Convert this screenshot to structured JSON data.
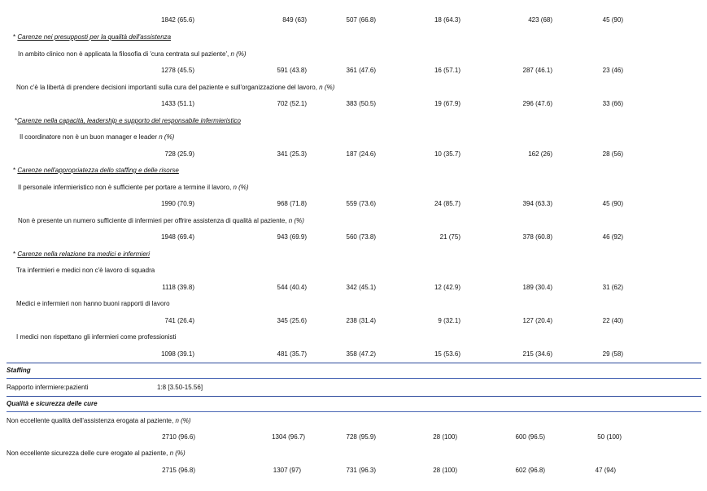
{
  "rows": [
    {
      "type": "values",
      "cells": [
        "1842 (65.6)",
        "849 (63)",
        "507 (66.8)",
        "18 (64.3)",
        "423 (68)",
        "45 (90)"
      ]
    },
    {
      "type": "category",
      "prefix": "* ",
      "label": "Carenze nei presupposti per la qualità dell'assistenza"
    },
    {
      "type": "item",
      "label": "In ambito clinico non è applicata la filosofia di 'cura centrata sul paziente', ",
      "suffix": "n (%)"
    },
    {
      "type": "values",
      "cells": [
        "1278 (45.5)",
        "591 (43.8)",
        "361 (47.6)",
        "16 (57.1)",
        "287 (46.1)",
        "23 (46)"
      ]
    },
    {
      "type": "item",
      "label": "Non c'è la libertà di prendere decisioni importanti sulla cura del paziente e sull'organizzazione del lavoro, ",
      "suffix": "n (%)"
    },
    {
      "type": "values",
      "cells": [
        "1433 (51.1)",
        "702 (52.1)",
        "383 (50.5)",
        "19 (67.9)",
        "296 (47.6)",
        "33 (66)"
      ]
    },
    {
      "type": "category",
      "prefix": "*",
      "label": "Carenze nella capacità, leadership e supporto del responsabile infermieristico"
    },
    {
      "type": "item",
      "label": "Il coordinatore non è un buon manager e leader ",
      "suffix": "n (%)"
    },
    {
      "type": "values",
      "cells": [
        "728 (25.9)",
        "341 (25.3)",
        "187 (24.6)",
        "10 (35.7)",
        "162 (26)",
        "28 (56)"
      ]
    },
    {
      "type": "category",
      "prefix": "* ",
      "label": "Carenze nell'appropriatezza dello staffing e delle risorse"
    },
    {
      "type": "item",
      "label": "Il personale infermieristico non è sufficiente per portare a termine il lavoro, ",
      "suffix": "n (%)"
    },
    {
      "type": "values",
      "cells": [
        "1990 (70.9)",
        "968 (71.8)",
        "559 (73.6)",
        "24 (85.7)",
        "394 (63.3)",
        "45 (90)"
      ]
    },
    {
      "type": "item",
      "label": "Non è presente un numero sufficiente di infermieri per offrire assistenza di qualità al paziente, ",
      "suffix": "n (%)"
    },
    {
      "type": "values",
      "cells": [
        "1948 (69.4)",
        "943 (69.9)",
        "560 (73.8)",
        "21 (75)",
        "378 (60.8)",
        "46 (92)"
      ]
    },
    {
      "type": "category",
      "prefix": "* ",
      "label": "Carenze nella relazione tra medici e infermieri"
    },
    {
      "type": "item",
      "label": "Tra infermieri e medici non c'è lavoro di squadra",
      "suffix": ""
    },
    {
      "type": "values",
      "cells": [
        "1118 (39.8)",
        "544 (40.4)",
        "342 (45.1)",
        "12 (42.9)",
        "189 (30.4)",
        "31 (62)"
      ]
    },
    {
      "type": "item",
      "label": "Medici e infermieri non hanno buoni rapporti di lavoro",
      "suffix": ""
    },
    {
      "type": "values",
      "cells": [
        "741 (26.4)",
        "345 (25.6)",
        "238 (31.4)",
        "9 (32.1)",
        "127 (20.4)",
        "22 (40)"
      ]
    },
    {
      "type": "item",
      "label": "I medici non rispettano gli infermieri come professionisti",
      "suffix": ""
    },
    {
      "type": "values",
      "cells": [
        "1098 (39.1)",
        "481 (35.7)",
        "358 (47.2)",
        "15 (53.6)",
        "215 (34.6)",
        "29 (58)"
      ]
    },
    {
      "type": "section",
      "label": "Staffing"
    },
    {
      "type": "ratio",
      "label": "Rapporto infermiere:pazienti",
      "value": "1:8 [3.50-15.56]"
    },
    {
      "type": "section",
      "label": "Qualità  e sicurezza delle cure"
    },
    {
      "type": "item",
      "label": "Non eccellente qualità dell'assistenza erogata al paziente, ",
      "suffix": "n (%)"
    },
    {
      "type": "values",
      "cells": [
        "2710 (96.6)",
        "1304 (96.7)",
        "728 (95.9)",
        "28 (100)",
        "600 (96.5)",
        "50 (100)"
      ]
    },
    {
      "type": "item",
      "label": "Non eccellente sicurezza delle cure erogate al paziente, ",
      "suffix": "n (%)"
    },
    {
      "type": "values",
      "cells": [
        "2715 (96.8)",
        "1307 (97)",
        "731 (96.3)",
        "28 (100)",
        "602 (96.8)",
        "47 (94)"
      ]
    }
  ]
}
